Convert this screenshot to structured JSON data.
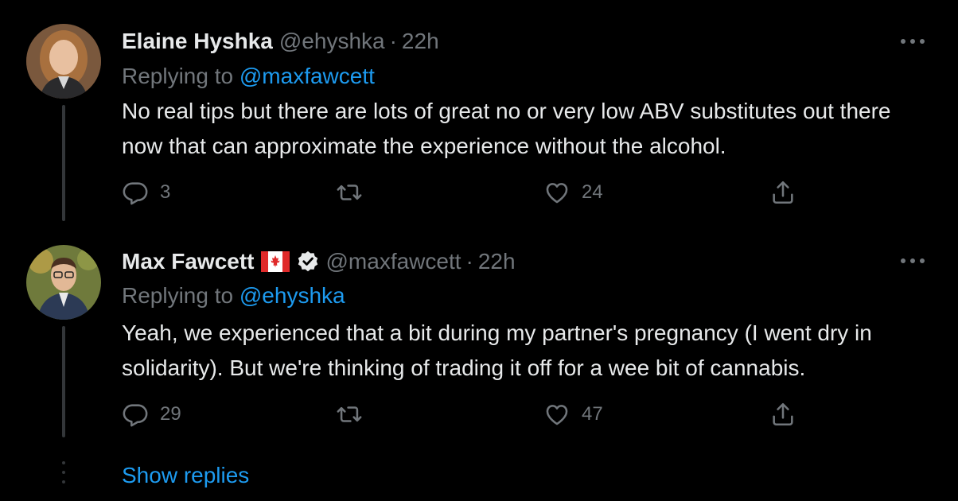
{
  "theme": {
    "background": "#000000",
    "text": "#e7e9ea",
    "muted": "#71767b",
    "accent": "#1d9bf0",
    "thread_line": "#333639"
  },
  "tweets": [
    {
      "display_name": "Elaine Hyshka",
      "handle": "@ehyshka",
      "separator": "·",
      "time": "22h",
      "replying_prefix": "Replying to",
      "replying_to": "@maxfawcett",
      "text": "No real tips but there are lots of great no or very low ABV substitutes out there now that can approximate the experience without the alcohol.",
      "replies": "3",
      "retweets": "",
      "likes": "24",
      "avatar_icon": "avatar-photo",
      "flag_icon": "",
      "verified": false
    },
    {
      "display_name": "Max Fawcett",
      "handle": "@maxfawcett",
      "separator": "·",
      "time": "22h",
      "replying_prefix": "Replying to",
      "replying_to": "@ehyshka",
      "text": "Yeah, we experienced that a bit during my partner's pregnancy (I went dry in solidarity). But we're thinking of trading it off for a wee bit of cannabis.",
      "replies": "29",
      "retweets": "",
      "likes": "47",
      "avatar_icon": "avatar-photo",
      "flag_icon": "canada-flag-icon",
      "verified": true
    }
  ],
  "show_replies": "Show replies"
}
